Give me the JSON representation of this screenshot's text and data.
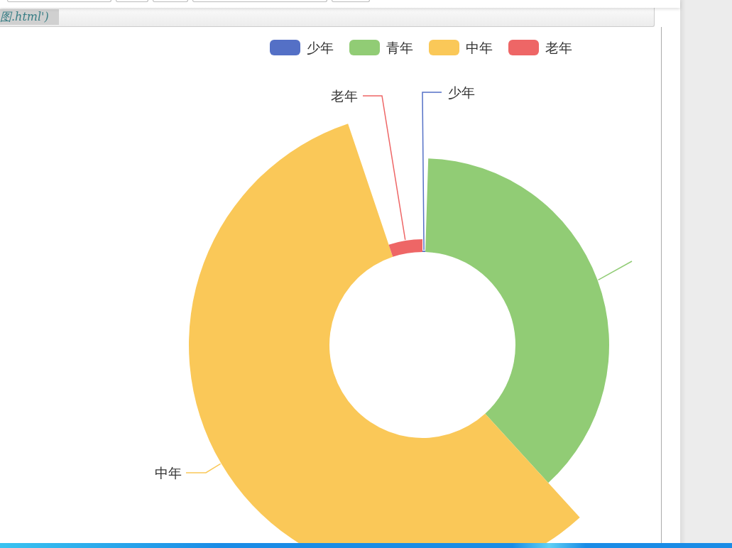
{
  "code_snippet": "图.html')",
  "legend": [
    {
      "label": "少年",
      "color": "#5470c6"
    },
    {
      "label": "青年",
      "color": "#91cc75"
    },
    {
      "label": "中年",
      "color": "#fac858"
    },
    {
      "label": "老年",
      "color": "#ee6666"
    }
  ],
  "slices": [
    {
      "label": "少年",
      "color": "#5470c6"
    },
    {
      "color": "#91cc75"
    },
    {
      "label": "中年",
      "color": "#fac858"
    },
    {
      "label": "老年",
      "color": "#ee6666"
    }
  ]
}
